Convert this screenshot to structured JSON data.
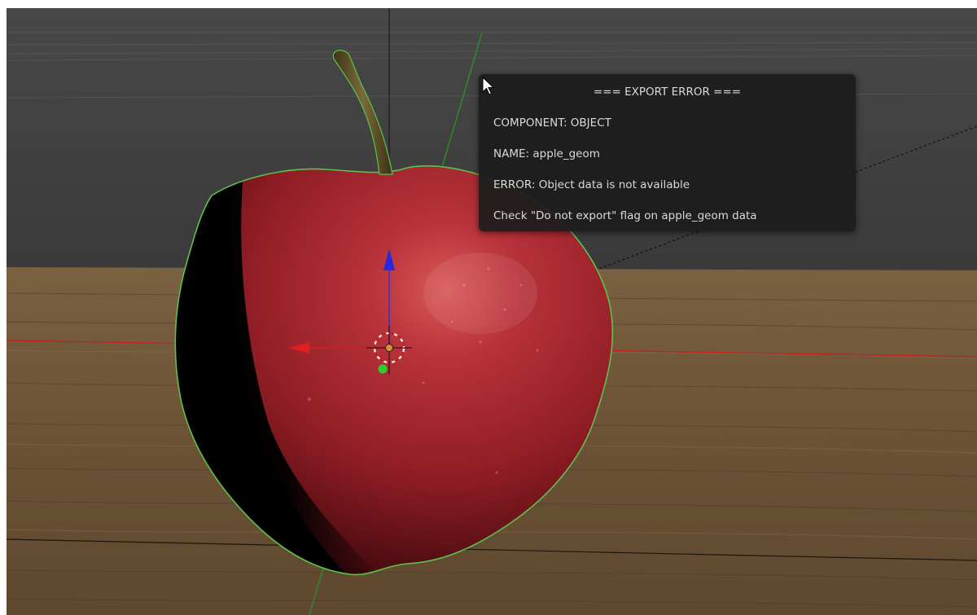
{
  "app": "3D viewport",
  "export_error": {
    "title": "=== EXPORT ERROR ===",
    "lines": [
      "COMPONENT: OBJECT",
      "NAME: apple_geom",
      "ERROR: Object data is not available",
      "Check \"Do not export\" flag on apple_geom data"
    ]
  },
  "colors": {
    "viewport_bg": "#3d3d3d",
    "floor": "#6e5538",
    "apple_red": "#a8202a",
    "selection_outline": "#5ec24a",
    "x_axis": "#c81e1e",
    "y_axis": "#2aa02a",
    "tooltip_bg": "#1c1c1c",
    "tooltip_text": "#d9d9d9"
  },
  "gizmo": {
    "icons": [
      "z-axis-arrow-icon",
      "x-axis-arrow-icon",
      "y-axis-handle-icon",
      "3d-cursor-icon",
      "object-origin-icon"
    ]
  },
  "cursor": "mouse-pointer-icon"
}
